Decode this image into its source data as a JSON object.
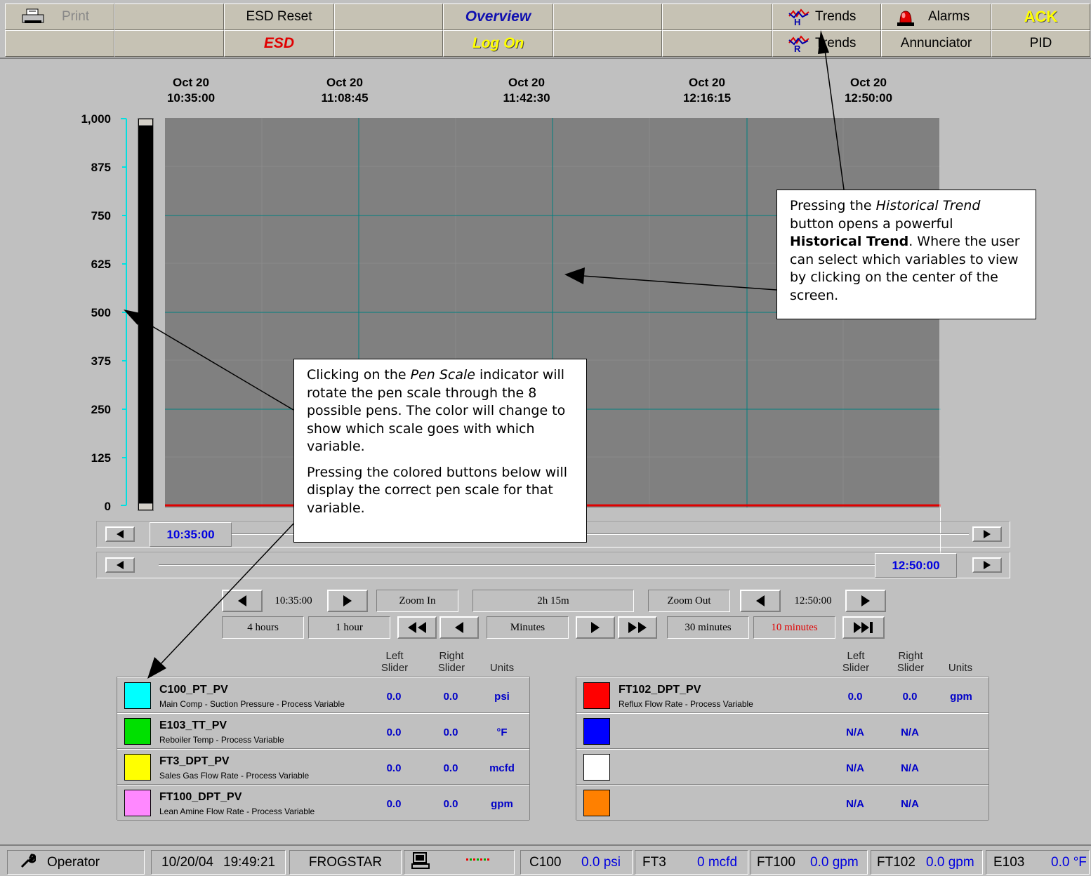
{
  "toolbar": {
    "row1": [
      "Print",
      "",
      "ESD Reset",
      "",
      "Overview",
      "",
      "",
      "Trends",
      "Alarms",
      "ACK"
    ],
    "row2": [
      "",
      "",
      "ESD",
      "",
      "Log On",
      "",
      "",
      "Trends",
      "Annunciator",
      "PID"
    ]
  },
  "trend": {
    "time_labels": [
      {
        "date": "Oct 20",
        "time": "10:35:00"
      },
      {
        "date": "Oct 20",
        "time": "11:08:45"
      },
      {
        "date": "Oct 20",
        "time": "11:42:30"
      },
      {
        "date": "Oct 20",
        "time": "12:16:15"
      },
      {
        "date": "Oct 20",
        "time": "12:50:00"
      }
    ],
    "y_ticks": [
      "1,000",
      "875",
      "750",
      "625",
      "500",
      "375",
      "250",
      "125",
      "0"
    ],
    "left_cursor_time": "10:35:00",
    "right_cursor_time": "12:50:00"
  },
  "controls": {
    "row1": {
      "left_time": "10:35:00",
      "zoom_in": "Zoom In",
      "span": "2h 15m",
      "zoom_out": "Zoom Out",
      "right_time": "12:50:00"
    },
    "row2": {
      "four_hours": "4 hours",
      "one_hour": "1 hour",
      "minutes": "Minutes",
      "thirty_minutes": "30 minutes",
      "ten_minutes": "10 minutes"
    }
  },
  "pens": {
    "headers": {
      "left": "Left\nSlider",
      "right": "Right\nSlider",
      "units": "Units"
    },
    "left": [
      {
        "color": "#00ffff",
        "tag": "C100_PT_PV",
        "desc": "Main Comp - Suction Pressure - Process Variable",
        "left": "0.0",
        "right": "0.0",
        "units": "psi"
      },
      {
        "color": "#00e000",
        "tag": "E103_TT_PV",
        "desc": "Reboiler Temp - Process Variable",
        "left": "0.0",
        "right": "0.0",
        "units": "°F"
      },
      {
        "color": "#ffff00",
        "tag": "FT3_DPT_PV",
        "desc": "Sales Gas Flow Rate - Process Variable",
        "left": "0.0",
        "right": "0.0",
        "units": "mcfd"
      },
      {
        "color": "#ff88ff",
        "tag": "FT100_DPT_PV",
        "desc": "Lean Amine Flow Rate - Process Variable",
        "left": "0.0",
        "right": "0.0",
        "units": "gpm"
      }
    ],
    "right": [
      {
        "color": "#ff0000",
        "tag": "FT102_DPT_PV",
        "desc": "Reflux Flow Rate - Process Variable",
        "left": "0.0",
        "right": "0.0",
        "units": "gpm"
      },
      {
        "color": "#0000ff",
        "tag": "",
        "desc": "",
        "left": "N/A",
        "right": "N/A",
        "units": ""
      },
      {
        "color": "#ffffff",
        "tag": "",
        "desc": "",
        "left": "N/A",
        "right": "N/A",
        "units": ""
      },
      {
        "color": "#ff8000",
        "tag": "",
        "desc": "",
        "left": "N/A",
        "right": "N/A",
        "units": ""
      }
    ]
  },
  "callouts": {
    "historical": {
      "p1": "Pressing the ",
      "p1_em": "Historical Trend",
      "p2": " button opens a powerful ",
      "p2_strong": "Historical Trend",
      "p3": ". Where the user can select which variables to view by clicking on the center of the screen."
    },
    "penscale": {
      "a1": "Clicking on the ",
      "a1_em": "Pen Scale",
      "a2": " indicator will rotate the pen scale through the 8 possible pens. The color will change to show which scale goes with which variable.",
      "b": "Pressing the colored buttons below will display the correct pen scale for that variable."
    }
  },
  "statusbar": {
    "user": "Operator",
    "date": "10/20/04",
    "time": "19:49:21",
    "node": "FROGSTAR",
    "readings": [
      {
        "name": "C100",
        "value": "0.0 psi"
      },
      {
        "name": "FT3",
        "value": "0 mcfd"
      },
      {
        "name": "FT100",
        "value": "0.0 gpm"
      },
      {
        "name": "FT102",
        "value": "0.0 gpm"
      },
      {
        "name": "E103",
        "value": "0.0 °F"
      }
    ]
  },
  "colors": {
    "pen_scale": "#00e0e0",
    "trend_line": "#e00000",
    "chart_bg": "#808080",
    "grid": "#007f80"
  }
}
